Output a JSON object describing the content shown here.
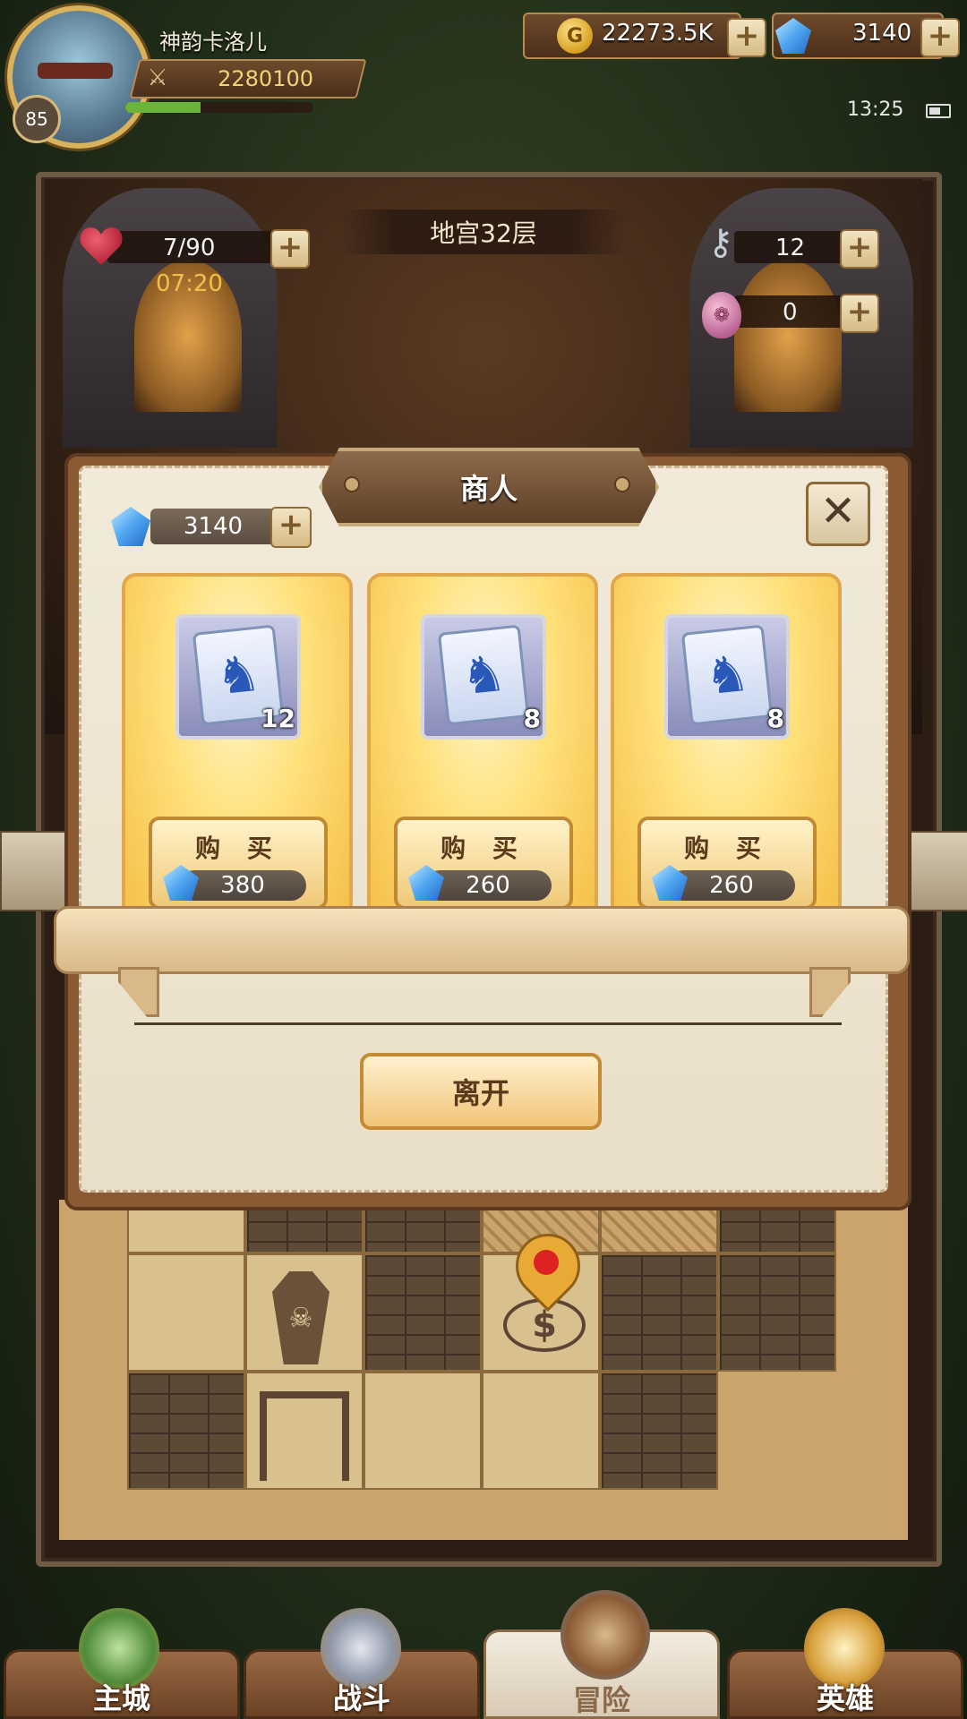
{
  "player": {
    "name": "神韵卡洛儿",
    "level": "85",
    "power": "2280100",
    "exp_fraction": 0.4
  },
  "resources": {
    "gold": "22273.5K",
    "gems": "3140"
  },
  "status_bar": {
    "time": "13:25"
  },
  "dungeon": {
    "floor_title": "地宫32层",
    "stamina": "7/90",
    "stamina_timer": "07:20",
    "keys": "12",
    "eggs": "0"
  },
  "merchant": {
    "title": "商人",
    "gem_balance": "3140",
    "items": [
      {
        "count": "12",
        "buy_label": "购 买",
        "price": "380"
      },
      {
        "count": "8",
        "buy_label": "购 买",
        "price": "260"
      },
      {
        "count": "8",
        "buy_label": "购 买",
        "price": "260"
      }
    ],
    "leave_label": "离开"
  },
  "nav": {
    "tabs": [
      {
        "label": "主城",
        "icon": "castle-icon",
        "active": false
      },
      {
        "label": "战斗",
        "icon": "crossed-swords-icon",
        "active": false
      },
      {
        "label": "冒险",
        "icon": "adventure-map-icon",
        "active": true
      },
      {
        "label": "英雄",
        "icon": "hero-helmet-icon",
        "active": false
      }
    ]
  },
  "colors": {
    "gold_text": "#f1d47a",
    "timer": "#f0c04a",
    "exp_bar": "#6bb63a",
    "map_pin": "#d22222"
  }
}
